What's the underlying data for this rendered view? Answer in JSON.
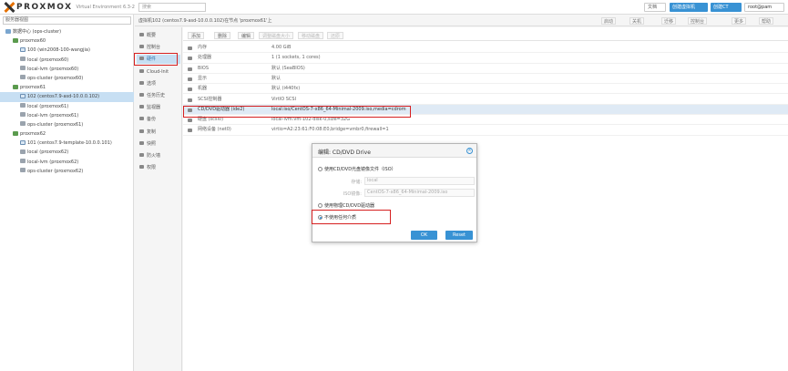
{
  "topbar": {
    "logo_text": "PROXMOX",
    "logo_sub": "Virtual Environment 6.3-2",
    "search_placeholder": "搜索",
    "doc_label": "文档",
    "create_vm_label": "创建虚拟机",
    "create_ct_label": "创建CT",
    "user_label": "root@pam"
  },
  "tree": {
    "view_label": "服务器视图",
    "items": [
      {
        "label": "数据中心 (ops-cluster)",
        "type": "dc",
        "indent": 0
      },
      {
        "label": "proxmox60",
        "type": "node",
        "indent": 1
      },
      {
        "label": "100 (win2008-100-wangjia)",
        "type": "vm",
        "indent": 2
      },
      {
        "label": "local (proxmox60)",
        "type": "storage",
        "indent": 2
      },
      {
        "label": "local-lvm (proxmox60)",
        "type": "storage",
        "indent": 2
      },
      {
        "label": "ops-cluster (proxmox60)",
        "type": "storage",
        "indent": 2
      },
      {
        "label": "proxmox61",
        "type": "node",
        "indent": 1
      },
      {
        "label": "102 (centos7.9-asd-10.0.0.102)",
        "type": "vm",
        "indent": 2,
        "selected": true
      },
      {
        "label": "local (proxmox61)",
        "type": "storage",
        "indent": 2
      },
      {
        "label": "local-lvm (proxmox61)",
        "type": "storage",
        "indent": 2
      },
      {
        "label": "ops-cluster (proxmox61)",
        "type": "storage",
        "indent": 2
      },
      {
        "label": "proxmox62",
        "type": "node",
        "indent": 1
      },
      {
        "label": "101 (centos7.9-template-10.0.0.101)",
        "type": "vm",
        "indent": 2
      },
      {
        "label": "local (proxmox62)",
        "type": "storage",
        "indent": 2
      },
      {
        "label": "local-lvm (proxmox62)",
        "type": "storage",
        "indent": 2
      },
      {
        "label": "ops-cluster (proxmox62)",
        "type": "storage",
        "indent": 2
      }
    ]
  },
  "content": {
    "title": "虚拟机102 (centos7.9-asd-10.0.0.102)在节点 'proxmox61'上",
    "buttons": [
      "启动",
      "关机",
      "迁移",
      "控制台",
      "更多",
      "帮助"
    ]
  },
  "vmnav": {
    "items": [
      "概要",
      "控制台",
      "硬件",
      "Cloud-Init",
      "选项",
      "任务历史",
      "监视器",
      "备份",
      "复制",
      "快照",
      "防火墙",
      "权限"
    ],
    "active_index": 2
  },
  "hardware": {
    "toolbar": [
      "添加",
      "删除",
      "编辑",
      "调整磁盘大小",
      "移动磁盘",
      "还原"
    ],
    "rows": [
      {
        "key": "内存",
        "value": "4.00 GiB"
      },
      {
        "key": "处理器",
        "value": "1 (1 sockets, 1 cores)"
      },
      {
        "key": "BIOS",
        "value": "默认 (SeaBIOS)"
      },
      {
        "key": "显示",
        "value": "默认"
      },
      {
        "key": "机器",
        "value": "默认 (i440fx)"
      },
      {
        "key": "SCSI控制器",
        "value": "VirtIO SCSI"
      },
      {
        "key": "CD/DVD驱动器 (ide2)",
        "value": "local:iso/CentOS-7-x86_64-Minimal-2009.iso,media=cdrom",
        "selected": true
      },
      {
        "key": "硬盘 (scsi0)",
        "value": "local-lvm:vm-102-disk-0,size=32G"
      },
      {
        "key": "网络设备 (net0)",
        "value": "virtio=A2:23:61:F0:08:E0,bridge=vmbr0,firewall=1"
      }
    ]
  },
  "dialog": {
    "title": "编辑: CD/DVD Drive",
    "close_glyph": "×",
    "option_iso": "使用CD/DVD光盘镜像文件（ISO）",
    "storage_label": "存储:",
    "storage_value": "local",
    "iso_label": "ISO镜像:",
    "iso_value": "CentOS-7-x86_64-Minimal-2009.iso",
    "option_physical": "使用物理CD/DVD驱动器",
    "option_none": "不使用任何介质",
    "ok_label": "OK",
    "reset_label": "Reset"
  }
}
